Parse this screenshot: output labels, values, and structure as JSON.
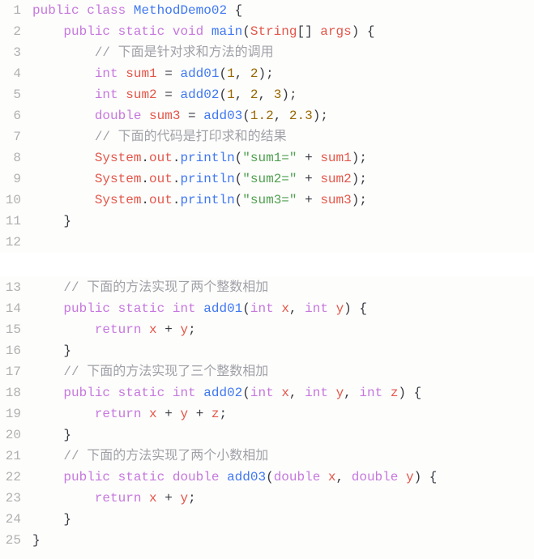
{
  "code": {
    "block1": {
      "lines": [
        {
          "n": "1",
          "html": "<span class='kw'>public</span> <span class='kw'>class</span> <span class='name'>MethodDemo02</span> <span class='pun'>{</span>"
        },
        {
          "n": "2",
          "html": "    <span class='kw'>public</span> <span class='kw'>static</span> <span class='type'>void</span> <span class='name'>main</span><span class='pun'>(</span><span class='red'>String</span><span class='pun'>[]</span> <span class='red'>args</span><span class='pun'>)</span> <span class='pun'>{</span>"
        },
        {
          "n": "3",
          "html": "        <span class='cmt'>// 下面是针对求和方法的调用</span>"
        },
        {
          "n": "4",
          "html": "        <span class='type'>int</span> <span class='red'>sum1</span> <span class='op'>=</span> <span class='name'>add01</span><span class='pun'>(</span><span class='num'>1</span><span class='pun'>,</span> <span class='num'>2</span><span class='pun'>);</span>"
        },
        {
          "n": "5",
          "html": "        <span class='type'>int</span> <span class='red'>sum2</span> <span class='op'>=</span> <span class='name'>add02</span><span class='pun'>(</span><span class='num'>1</span><span class='pun'>,</span> <span class='num'>2</span><span class='pun'>,</span> <span class='num'>3</span><span class='pun'>);</span>"
        },
        {
          "n": "6",
          "html": "        <span class='type'>double</span> <span class='red'>sum3</span> <span class='op'>=</span> <span class='name'>add03</span><span class='pun'>(</span><span class='num'>1.2</span><span class='pun'>,</span> <span class='num'>2.3</span><span class='pun'>);</span>"
        },
        {
          "n": "7",
          "html": "        <span class='cmt'>// 下面的代码是打印求和的结果</span>"
        },
        {
          "n": "8",
          "html": "        <span class='red'>System</span><span class='pun'>.</span><span class='red'>out</span><span class='pun'>.</span><span class='name'>println</span><span class='pun'>(</span><span class='str'>\"sum1=\"</span> <span class='op'>+</span> <span class='red'>sum1</span><span class='pun'>);</span>"
        },
        {
          "n": "9",
          "html": "        <span class='red'>System</span><span class='pun'>.</span><span class='red'>out</span><span class='pun'>.</span><span class='name'>println</span><span class='pun'>(</span><span class='str'>\"sum2=\"</span> <span class='op'>+</span> <span class='red'>sum2</span><span class='pun'>);</span>"
        },
        {
          "n": "10",
          "html": "        <span class='red'>System</span><span class='pun'>.</span><span class='red'>out</span><span class='pun'>.</span><span class='name'>println</span><span class='pun'>(</span><span class='str'>\"sum3=\"</span> <span class='op'>+</span> <span class='red'>sum3</span><span class='pun'>);</span>"
        },
        {
          "n": "11",
          "html": "    <span class='pun'>}</span>"
        },
        {
          "n": "12",
          "html": ""
        }
      ]
    },
    "block2": {
      "lines": [
        {
          "n": "13",
          "html": "    <span class='cmt'>// 下面的方法实现了两个整数相加</span>"
        },
        {
          "n": "14",
          "html": "    <span class='kw'>public</span> <span class='kw'>static</span> <span class='type'>int</span> <span class='name'>add01</span><span class='pun'>(</span><span class='type'>int</span> <span class='red'>x</span><span class='pun'>,</span> <span class='type'>int</span> <span class='red'>y</span><span class='pun'>)</span> <span class='pun'>{</span>"
        },
        {
          "n": "15",
          "html": "        <span class='kw'>return</span> <span class='red'>x</span> <span class='op'>+</span> <span class='red'>y</span><span class='pun'>;</span>"
        },
        {
          "n": "16",
          "html": "    <span class='pun'>}</span>"
        },
        {
          "n": "17",
          "html": "    <span class='cmt'>// 下面的方法实现了三个整数相加</span>"
        },
        {
          "n": "18",
          "html": "    <span class='kw'>public</span> <span class='kw'>static</span> <span class='type'>int</span> <span class='name'>add02</span><span class='pun'>(</span><span class='type'>int</span> <span class='red'>x</span><span class='pun'>,</span> <span class='type'>int</span> <span class='red'>y</span><span class='pun'>,</span> <span class='type'>int</span> <span class='red'>z</span><span class='pun'>)</span> <span class='pun'>{</span>"
        },
        {
          "n": "19",
          "html": "        <span class='kw'>return</span> <span class='red'>x</span> <span class='op'>+</span> <span class='red'>y</span> <span class='op'>+</span> <span class='red'>z</span><span class='pun'>;</span>"
        },
        {
          "n": "20",
          "html": "    <span class='pun'>}</span>"
        },
        {
          "n": "21",
          "html": "    <span class='cmt'>// 下面的方法实现了两个小数相加</span>"
        },
        {
          "n": "22",
          "html": "    <span class='kw'>public</span> <span class='kw'>static</span> <span class='type'>double</span> <span class='name'>add03</span><span class='pun'>(</span><span class='type'>double</span> <span class='red'>x</span><span class='pun'>,</span> <span class='type'>double</span> <span class='red'>y</span><span class='pun'>)</span> <span class='pun'>{</span>"
        },
        {
          "n": "23",
          "html": "        <span class='kw'>return</span> <span class='red'>x</span> <span class='op'>+</span> <span class='red'>y</span><span class='pun'>;</span>"
        },
        {
          "n": "24",
          "html": "    <span class='pun'>}</span>"
        },
        {
          "n": "25",
          "html": "<span class='pun'>}</span>"
        }
      ]
    }
  }
}
